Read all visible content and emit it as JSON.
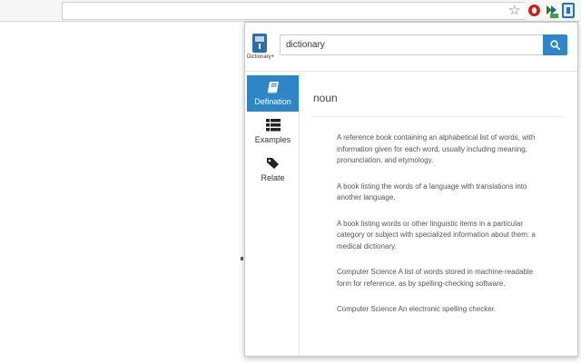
{
  "browser": {
    "icons": [
      "star-icon",
      "opera-icon",
      "arrows-icon",
      "dictionary-extension-icon"
    ]
  },
  "popup": {
    "logo_label": "Dictionary+",
    "search": {
      "value": "dictionary",
      "icon": "search-icon"
    },
    "colors": {
      "accent": "#2f86c6"
    },
    "sidebar": {
      "items": [
        {
          "label": "Defination",
          "icon": "book-icon",
          "active": true
        },
        {
          "label": "Examples",
          "icon": "list-icon",
          "active": false
        },
        {
          "label": "Relate",
          "icon": "tag-icon",
          "active": false
        }
      ]
    },
    "content": {
      "part_of_speech": "noun",
      "definitions": [
        "A reference book containing an alphabetical list of words, with information given for each word, usually including meaning, pronunciation, and etymology.",
        "A book listing the words of a language with translations into another language.",
        "A book listing words or other linguistic items in a particular category or subject with specialized information about them: a medical dictionary.",
        "Computer Science A list of words stored in machine-readable form for reference, as by spelling-checking software.",
        "Computer Science An electronic spelling checker."
      ]
    }
  }
}
